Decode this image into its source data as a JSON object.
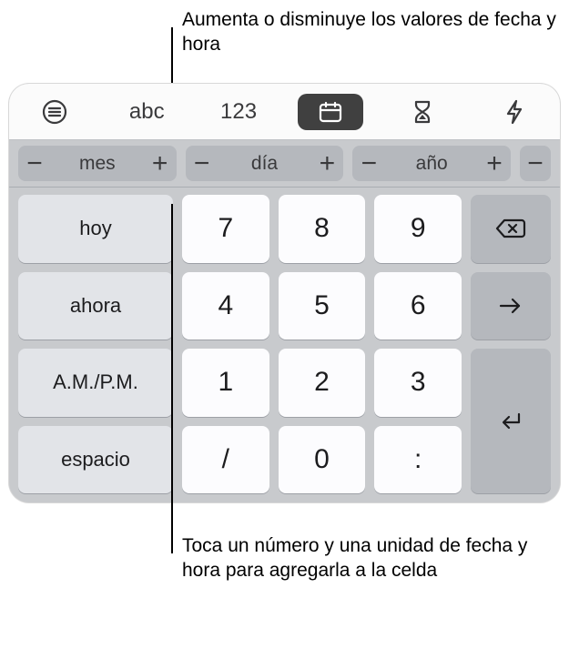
{
  "callouts": {
    "top": "Aumenta o disminuye los valores de fecha y hora",
    "bottom": "Toca un número y una unidad de fecha y hora para agregarla a la celda"
  },
  "tabs": {
    "abc_label": "abc",
    "num_label": "123"
  },
  "switches": {
    "minus": "−",
    "plus": "+",
    "month": "mes",
    "day": "día",
    "year": "año"
  },
  "wordkeys": {
    "today": "hoy",
    "now": "ahora",
    "ampm": "A.M./P.M.",
    "space": "espacio"
  },
  "digits": {
    "d7": "7",
    "d8": "8",
    "d9": "9",
    "d4": "4",
    "d5": "5",
    "d6": "6",
    "d1": "1",
    "d2": "2",
    "d3": "3",
    "slash": "/",
    "d0": "0",
    "colon": ":"
  }
}
